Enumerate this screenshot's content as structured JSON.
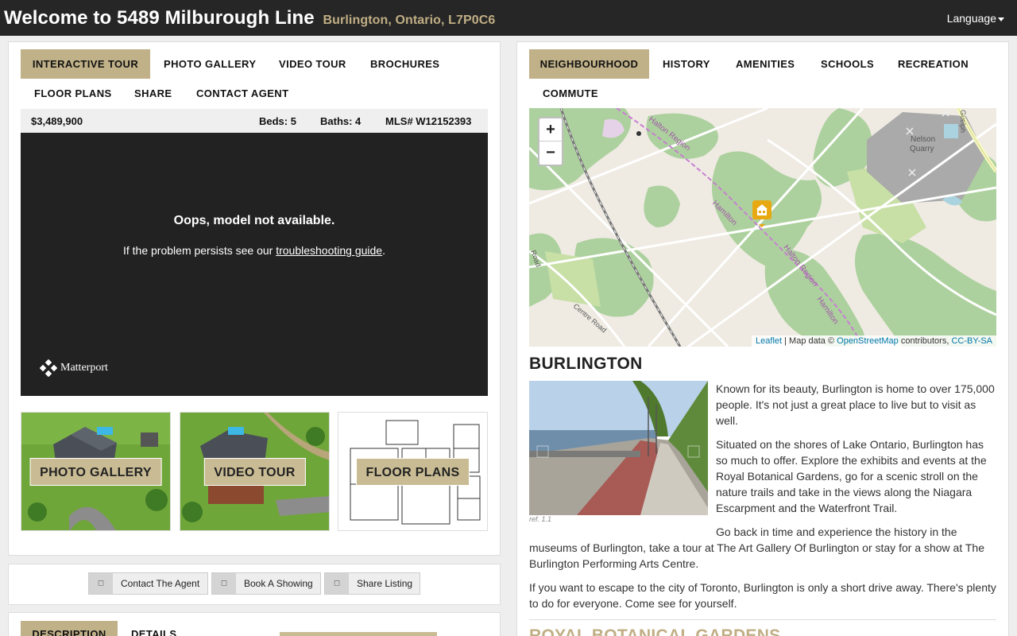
{
  "header": {
    "title": "Welcome to 5489 Milburough Line",
    "location": "Burlington, Ontario, L7P0C6",
    "language_label": "Language"
  },
  "left_tabs": [
    "INTERACTIVE TOUR",
    "PHOTO GALLERY",
    "VIDEO TOUR",
    "BROCHURES",
    "FLOOR PLANS",
    "SHARE",
    "CONTACT AGENT"
  ],
  "property": {
    "price": "$3,489,900",
    "beds": "Beds: 5",
    "baths": "Baths: 4",
    "mls": "MLS# W12152393"
  },
  "viewer": {
    "error_title": "Oops, model not available.",
    "help_prefix": "If the problem persists see our ",
    "help_link": "troubleshooting guide",
    "help_suffix": ".",
    "brand": "Matterport"
  },
  "thumbnails": [
    "PHOTO GALLERY",
    "VIDEO TOUR",
    "FLOOR PLANS"
  ],
  "actions": [
    "Contact The Agent",
    "Book A Showing",
    "Share Listing"
  ],
  "bottom_tabs": [
    "DESCRIPTION",
    "DETAILS"
  ],
  "right_tabs": [
    "NEIGHBOURHOOD",
    "HISTORY",
    "AMENITIES",
    "SCHOOLS",
    "RECREATION",
    "COMMUTE"
  ],
  "map": {
    "zoom_in": "+",
    "zoom_out": "−",
    "labels": {
      "halton_region_1": "Halton Region",
      "halton_region_2": "Halton Region",
      "hamilton_1": "Hamilton",
      "hamilton_2": "Hamilton",
      "nelson_quarry_1": "Nelson",
      "nelson_quarry_2": "Quarry",
      "centre_road_1": "Centre Road",
      "centre_road_2": "Road",
      "guelph_line": "Guelph"
    },
    "attribution": {
      "leaflet": "Leaflet",
      "mid": " | Map data © ",
      "osm": "OpenStreetMap",
      "contrib": " contributors, ",
      "license": "CC-BY-SA"
    }
  },
  "neighbourhood": {
    "city": "BURLINGTON",
    "photo_ref": "ref. 1.1",
    "paragraphs": [
      "Known for its beauty, Burlington is home to over 175,000 people. It's not just a great place to live but to visit as well.",
      "Situated on the shores of Lake Ontario, Burlington has so much to offer. Explore the exhibits and events at the Royal Botanical Gardens, go for a scenic stroll on the nature trails and take in the views along the Niagara Escarpment and the Waterfront Trail.",
      "Go back in time and experience the history in the museums of Burlington, take a tour at The Art Gallery Of Burlington or stay for a show at The Burlington Performing Arts Centre.",
      "If you want to escape to the city of Toronto, Burlington is only a short drive away. There's plenty to do for everyone. Come see for yourself."
    ],
    "next_heading": "ROYAL BOTANICAL GARDENS"
  },
  "colors": {
    "header_bg": "#262626",
    "accent": "#c0b188",
    "location": "#c0ae84",
    "viewer_bg": "#222222",
    "map_green": "#add19e",
    "link": "#0078a8"
  }
}
